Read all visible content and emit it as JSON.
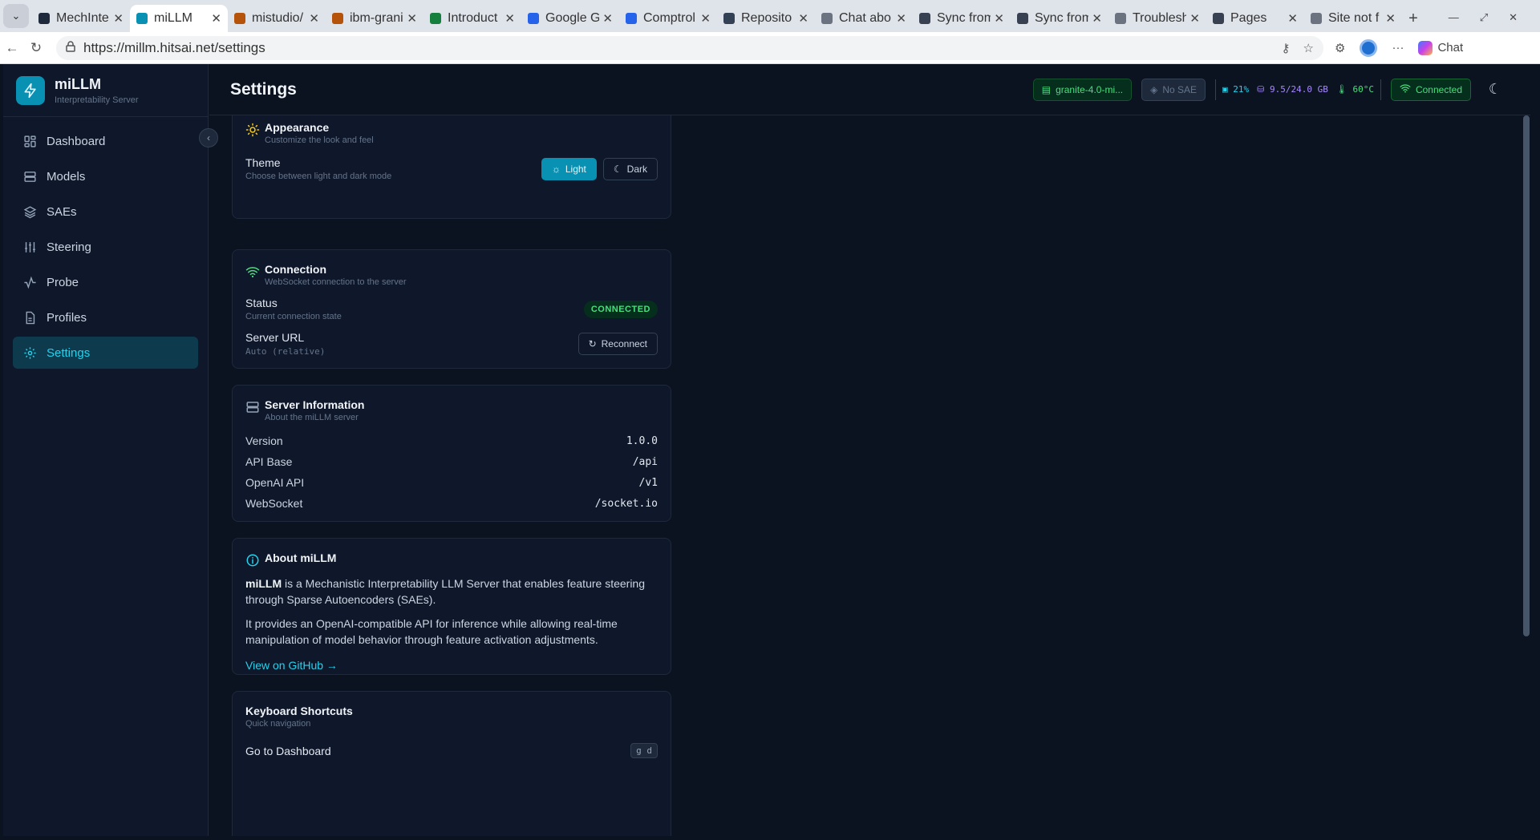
{
  "browser": {
    "tabs": [
      {
        "title": "MechInte",
        "color": "#1e293b"
      },
      {
        "title": "miLLM",
        "color": "#0891b2",
        "active": true
      },
      {
        "title": "mistudio/",
        "color": "#b45309"
      },
      {
        "title": "ibm-grani",
        "color": "#b45309"
      },
      {
        "title": "Introduct",
        "color": "#15803d"
      },
      {
        "title": "Google G",
        "color": "#2563eb"
      },
      {
        "title": "Comptrol",
        "color": "#2563eb"
      },
      {
        "title": "Reposito",
        "color": "#334155"
      },
      {
        "title": "Chat abo",
        "color": "#6b7280"
      },
      {
        "title": "Sync from",
        "color": "#374151"
      },
      {
        "title": "Sync from",
        "color": "#374151"
      },
      {
        "title": "Troublesh",
        "color": "#6b7280"
      },
      {
        "title": "Pages",
        "color": "#374151"
      },
      {
        "title": "Site not f",
        "color": "#6b7280"
      }
    ],
    "url": "https://millm.hitsai.net/settings",
    "chat_label": "Chat"
  },
  "app": {
    "name": "miLLM",
    "subtitle": "Interpretability Server",
    "nav": [
      {
        "label": "Dashboard",
        "icon": "dashboard-icon"
      },
      {
        "label": "Models",
        "icon": "server-icon"
      },
      {
        "label": "SAEs",
        "icon": "layers-icon"
      },
      {
        "label": "Steering",
        "icon": "sliders-icon"
      },
      {
        "label": "Probe",
        "icon": "activity-icon"
      },
      {
        "label": "Profiles",
        "icon": "file-icon"
      },
      {
        "label": "Settings",
        "icon": "gear-icon",
        "active": true
      }
    ]
  },
  "header": {
    "title": "Settings",
    "model_label": "granite-4.0-mi...",
    "sae_label": "No SAE",
    "gpu_util": "21%",
    "memory": "9.5/24.0 GB",
    "temperature": "60°C",
    "connection_label": "Connected"
  },
  "appearance": {
    "title": "Appearance",
    "desc": "Customize the look and feel",
    "theme_label": "Theme",
    "theme_desc": "Choose between light and dark mode",
    "light_label": "Light",
    "dark_label": "Dark",
    "selected": "Light"
  },
  "connection": {
    "title": "Connection",
    "desc": "WebSocket connection to the server",
    "status_label": "Status",
    "status_desc": "Current connection state",
    "status_value": "CONNECTED",
    "server_url_label": "Server URL",
    "server_url_value": "Auto (relative)",
    "reconnect_label": "Reconnect"
  },
  "server_info": {
    "title": "Server Information",
    "desc": "About the miLLM server",
    "rows": [
      {
        "k": "Version",
        "v": "1.0.0"
      },
      {
        "k": "API Base",
        "v": "/api"
      },
      {
        "k": "OpenAI API",
        "v": "/v1"
      },
      {
        "k": "WebSocket",
        "v": "/socket.io"
      }
    ]
  },
  "about": {
    "title": "About miLLM",
    "p1_bold": "miLLM",
    "p1_rest": " is a Mechanistic Interpretability LLM Server that enables feature steering through Sparse Autoencoders (SAEs).",
    "p2": "It provides an OpenAI-compatible API for inference while allowing real-time manipulation of model behavior through feature activation adjustments.",
    "link": "View on GitHub →"
  },
  "shortcuts": {
    "title": "Keyboard Shortcuts",
    "desc": "Quick navigation",
    "first_label": "Go to Dashboard",
    "first_key": "g d"
  },
  "colors": {
    "accent": "#0891b2",
    "success": "#4ade80",
    "background": "#0b1220"
  }
}
